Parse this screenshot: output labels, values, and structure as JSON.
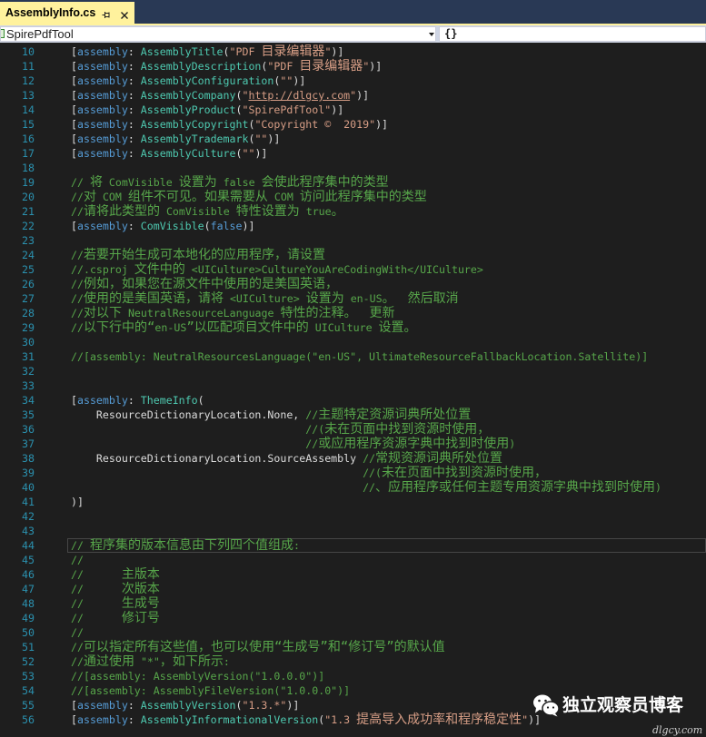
{
  "window": {
    "tabs": [
      {
        "label": "AssemblyInfo.cs",
        "active": true,
        "pin_icon": "pin-icon",
        "close_icon": "close-icon"
      }
    ]
  },
  "navbar": {
    "project": {
      "label": "SpirePdfTool",
      "icon": "csharp-project-icon",
      "arrow_icon": "chevron-down-icon"
    },
    "member": {
      "glyph": "{}",
      "icon": "braces-icon"
    }
  },
  "theme": {
    "tab_well": "#293955",
    "active_tab": "#FFF29D",
    "editor_bg": "#1E1E1E",
    "line_number": "#2B91AF",
    "tokens": {
      "pl": "#DCDCDC",
      "kw": "#569CD6",
      "type": "#4EC9B0",
      "str": "#D69D85",
      "url": "#D69D85",
      "cm": "#57A64A"
    }
  },
  "editor": {
    "cursor_line": 44,
    "lines": [
      {
        "n": 10,
        "tokens": [
          [
            "pl",
            "["
          ],
          [
            "kw",
            "assembly"
          ],
          [
            "pl",
            ": "
          ],
          [
            "type",
            "AssemblyTitle"
          ],
          [
            "pl",
            "("
          ],
          [
            "str",
            "\"PDF 目录编辑器\""
          ],
          [
            "pl",
            ")]"
          ]
        ]
      },
      {
        "n": 11,
        "tokens": [
          [
            "pl",
            "["
          ],
          [
            "kw",
            "assembly"
          ],
          [
            "pl",
            ": "
          ],
          [
            "type",
            "AssemblyDescription"
          ],
          [
            "pl",
            "("
          ],
          [
            "str",
            "\"PDF 目录编辑器\""
          ],
          [
            "pl",
            ")]"
          ]
        ]
      },
      {
        "n": 12,
        "tokens": [
          [
            "pl",
            "["
          ],
          [
            "kw",
            "assembly"
          ],
          [
            "pl",
            ": "
          ],
          [
            "type",
            "AssemblyConfiguration"
          ],
          [
            "pl",
            "("
          ],
          [
            "str",
            "\"\""
          ],
          [
            "pl",
            ")]"
          ]
        ]
      },
      {
        "n": 13,
        "tokens": [
          [
            "pl",
            "["
          ],
          [
            "kw",
            "assembly"
          ],
          [
            "pl",
            ": "
          ],
          [
            "type",
            "AssemblyCompany"
          ],
          [
            "pl",
            "("
          ],
          [
            "str",
            "\""
          ],
          [
            "url",
            "http://dlgcy.com"
          ],
          [
            "str",
            "\""
          ],
          [
            "pl",
            ")]"
          ]
        ]
      },
      {
        "n": 14,
        "tokens": [
          [
            "pl",
            "["
          ],
          [
            "kw",
            "assembly"
          ],
          [
            "pl",
            ": "
          ],
          [
            "type",
            "AssemblyProduct"
          ],
          [
            "pl",
            "("
          ],
          [
            "str",
            "\"SpirePdfTool\""
          ],
          [
            "pl",
            ")]"
          ]
        ]
      },
      {
        "n": 15,
        "tokens": [
          [
            "pl",
            "["
          ],
          [
            "kw",
            "assembly"
          ],
          [
            "pl",
            ": "
          ],
          [
            "type",
            "AssemblyCopyright"
          ],
          [
            "pl",
            "("
          ],
          [
            "str",
            "\"Copyright ©  2019\""
          ],
          [
            "pl",
            ")]"
          ]
        ]
      },
      {
        "n": 16,
        "tokens": [
          [
            "pl",
            "["
          ],
          [
            "kw",
            "assembly"
          ],
          [
            "pl",
            ": "
          ],
          [
            "type",
            "AssemblyTrademark"
          ],
          [
            "pl",
            "("
          ],
          [
            "str",
            "\"\""
          ],
          [
            "pl",
            ")]"
          ]
        ]
      },
      {
        "n": 17,
        "tokens": [
          [
            "pl",
            "["
          ],
          [
            "kw",
            "assembly"
          ],
          [
            "pl",
            ": "
          ],
          [
            "type",
            "AssemblyCulture"
          ],
          [
            "pl",
            "("
          ],
          [
            "str",
            "\"\""
          ],
          [
            "pl",
            ")]"
          ]
        ]
      },
      {
        "n": 18,
        "tokens": []
      },
      {
        "n": 19,
        "tokens": [
          [
            "cm",
            "// 将 ComVisible 设置为 false 会使此程序集中的类型"
          ]
        ]
      },
      {
        "n": 20,
        "tokens": [
          [
            "cm",
            "//对 COM 组件不可见。如果需要从 COM 访问此程序集中的类型"
          ]
        ]
      },
      {
        "n": 21,
        "tokens": [
          [
            "cm",
            "//请将此类型的 ComVisible 特性设置为 true。"
          ]
        ]
      },
      {
        "n": 22,
        "tokens": [
          [
            "pl",
            "["
          ],
          [
            "kw",
            "assembly"
          ],
          [
            "pl",
            ": "
          ],
          [
            "type",
            "ComVisible"
          ],
          [
            "pl",
            "("
          ],
          [
            "kw",
            "false"
          ],
          [
            "pl",
            ")]"
          ]
        ]
      },
      {
        "n": 23,
        "tokens": []
      },
      {
        "n": 24,
        "tokens": [
          [
            "cm",
            "//若要开始生成可本地化的应用程序，请设置"
          ]
        ]
      },
      {
        "n": 25,
        "tokens": [
          [
            "cm",
            "//.csproj 文件中的 <UICulture>CultureYouAreCodingWith</UICulture>"
          ]
        ]
      },
      {
        "n": 26,
        "tokens": [
          [
            "cm",
            "//例如，如果您在源文件中使用的是美国英语，"
          ]
        ]
      },
      {
        "n": 27,
        "tokens": [
          [
            "cm",
            "//使用的是美国英语，请将 <UICulture> 设置为 en-US。  然后取消"
          ]
        ]
      },
      {
        "n": 28,
        "tokens": [
          [
            "cm",
            "//对以下 NeutralResourceLanguage 特性的注释。  更新"
          ]
        ]
      },
      {
        "n": 29,
        "tokens": [
          [
            "cm",
            "//以下行中的“en-US”以匹配项目文件中的 UICulture 设置。"
          ]
        ]
      },
      {
        "n": 30,
        "tokens": []
      },
      {
        "n": 31,
        "tokens": [
          [
            "cm",
            "//[assembly: NeutralResourcesLanguage(\"en-US\", UltimateResourceFallbackLocation.Satellite)]"
          ]
        ]
      },
      {
        "n": 32,
        "tokens": []
      },
      {
        "n": 33,
        "tokens": []
      },
      {
        "n": 34,
        "tokens": [
          [
            "pl",
            "["
          ],
          [
            "kw",
            "assembly"
          ],
          [
            "pl",
            ": "
          ],
          [
            "type",
            "ThemeInfo"
          ],
          [
            "pl",
            "("
          ]
        ]
      },
      {
        "n": 35,
        "tokens": [
          [
            "pl",
            "    ResourceDictionaryLocation.None, "
          ],
          [
            "cm",
            "//主题特定资源词典所处位置"
          ]
        ]
      },
      {
        "n": 36,
        "tokens": [
          [
            "cm",
            "                                     //(未在页面中找到资源时使用，"
          ]
        ]
      },
      {
        "n": 37,
        "tokens": [
          [
            "cm",
            "                                     //或应用程序资源字典中找到时使用)"
          ]
        ]
      },
      {
        "n": 38,
        "tokens": [
          [
            "pl",
            "    ResourceDictionaryLocation.SourceAssembly "
          ],
          [
            "cm",
            "//常规资源词典所处位置"
          ]
        ]
      },
      {
        "n": 39,
        "tokens": [
          [
            "cm",
            "                                              //(未在页面中找到资源时使用，"
          ]
        ]
      },
      {
        "n": 40,
        "tokens": [
          [
            "cm",
            "                                              //、应用程序或任何主题专用资源字典中找到时使用)"
          ]
        ]
      },
      {
        "n": 41,
        "tokens": [
          [
            "pl",
            ")]"
          ]
        ]
      },
      {
        "n": 42,
        "tokens": []
      },
      {
        "n": 43,
        "tokens": []
      },
      {
        "n": 44,
        "tokens": [
          [
            "cm",
            "// 程序集的版本信息由下列四个值组成:"
          ]
        ]
      },
      {
        "n": 45,
        "tokens": [
          [
            "cm",
            "//"
          ]
        ]
      },
      {
        "n": 46,
        "tokens": [
          [
            "cm",
            "//      主版本"
          ]
        ]
      },
      {
        "n": 47,
        "tokens": [
          [
            "cm",
            "//      次版本"
          ]
        ]
      },
      {
        "n": 48,
        "tokens": [
          [
            "cm",
            "//      生成号"
          ]
        ]
      },
      {
        "n": 49,
        "tokens": [
          [
            "cm",
            "//      修订号"
          ]
        ]
      },
      {
        "n": 50,
        "tokens": [
          [
            "cm",
            "//"
          ]
        ]
      },
      {
        "n": 51,
        "tokens": [
          [
            "cm",
            "//可以指定所有这些值，也可以使用“生成号”和“修订号”的默认值"
          ]
        ]
      },
      {
        "n": 52,
        "tokens": [
          [
            "cm",
            "//通过使用 \"*\"，如下所示:"
          ]
        ]
      },
      {
        "n": 53,
        "tokens": [
          [
            "cm",
            "//[assembly: AssemblyVersion(\"1.0.0.0\")]"
          ]
        ]
      },
      {
        "n": 54,
        "tokens": [
          [
            "cm",
            "//[assembly: AssemblyFileVersion(\"1.0.0.0\")]"
          ]
        ]
      },
      {
        "n": 55,
        "tokens": [
          [
            "pl",
            "["
          ],
          [
            "kw",
            "assembly"
          ],
          [
            "pl",
            ": "
          ],
          [
            "type",
            "AssemblyVersion"
          ],
          [
            "pl",
            "("
          ],
          [
            "str",
            "\"1.3.*\""
          ],
          [
            "pl",
            ")]"
          ]
        ]
      },
      {
        "n": 56,
        "tokens": [
          [
            "pl",
            "["
          ],
          [
            "kw",
            "assembly"
          ],
          [
            "pl",
            ": "
          ],
          [
            "type",
            "AssemblyInformationalVersion"
          ],
          [
            "pl",
            "("
          ],
          [
            "str",
            "\"1.3 提高导入成功率和程序稳定性\""
          ],
          [
            "pl",
            ")]"
          ]
        ]
      }
    ]
  },
  "watermark": {
    "icon": "wechat-icon",
    "title": "独立观察员博客",
    "site": "dlgcy.com"
  }
}
